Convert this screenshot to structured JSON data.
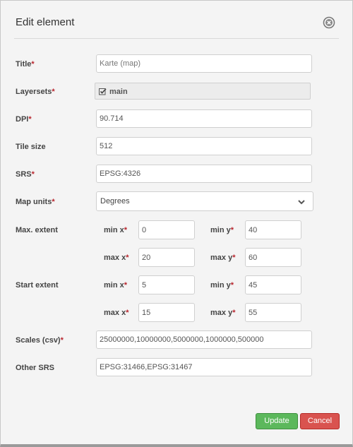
{
  "dialog": {
    "title": "Edit element",
    "close_icon": "close-circle-icon"
  },
  "form": {
    "title": {
      "label": "Title",
      "required": "*",
      "placeholder": "Karte (map)",
      "value": ""
    },
    "layersets": {
      "label": "Layersets",
      "required": "*",
      "option_label": "main",
      "checked": true,
      "check_icon": "checkbox-checked-icon"
    },
    "dpi": {
      "label": "DPI",
      "required": "*",
      "value": "90.714"
    },
    "tile_size": {
      "label": "Tile size",
      "value": "512"
    },
    "srs": {
      "label": "SRS",
      "required": "*",
      "value": "EPSG:4326"
    },
    "map_units": {
      "label": "Map units",
      "required": "*",
      "selected": "Degrees",
      "caret_icon": "chevron-down-icon"
    },
    "max_extent": {
      "label": "Max. extent",
      "min_x_label": "min x",
      "min_x": "0",
      "min_y_label": "min y",
      "min_y": "40",
      "max_x_label": "max x",
      "max_x": "20",
      "max_y_label": "max y",
      "max_y": "60",
      "required": "*"
    },
    "start_extent": {
      "label": "Start extent",
      "min_x_label": "min x",
      "min_x": "5",
      "min_y_label": "min y",
      "min_y": "45",
      "max_x_label": "max x",
      "max_x": "15",
      "max_y_label": "max y",
      "max_y": "55",
      "required": "*"
    },
    "scales": {
      "label": "Scales (csv)",
      "required": "*",
      "value": "25000000,10000000,5000000,1000000,500000"
    },
    "other_srs": {
      "label": "Other SRS",
      "value": "EPSG:31466,EPSG:31467"
    }
  },
  "buttons": {
    "update": "Update",
    "cancel": "Cancel"
  },
  "colors": {
    "required": "#b8262e",
    "update": "#5cb85c",
    "cancel": "#d9534f"
  }
}
